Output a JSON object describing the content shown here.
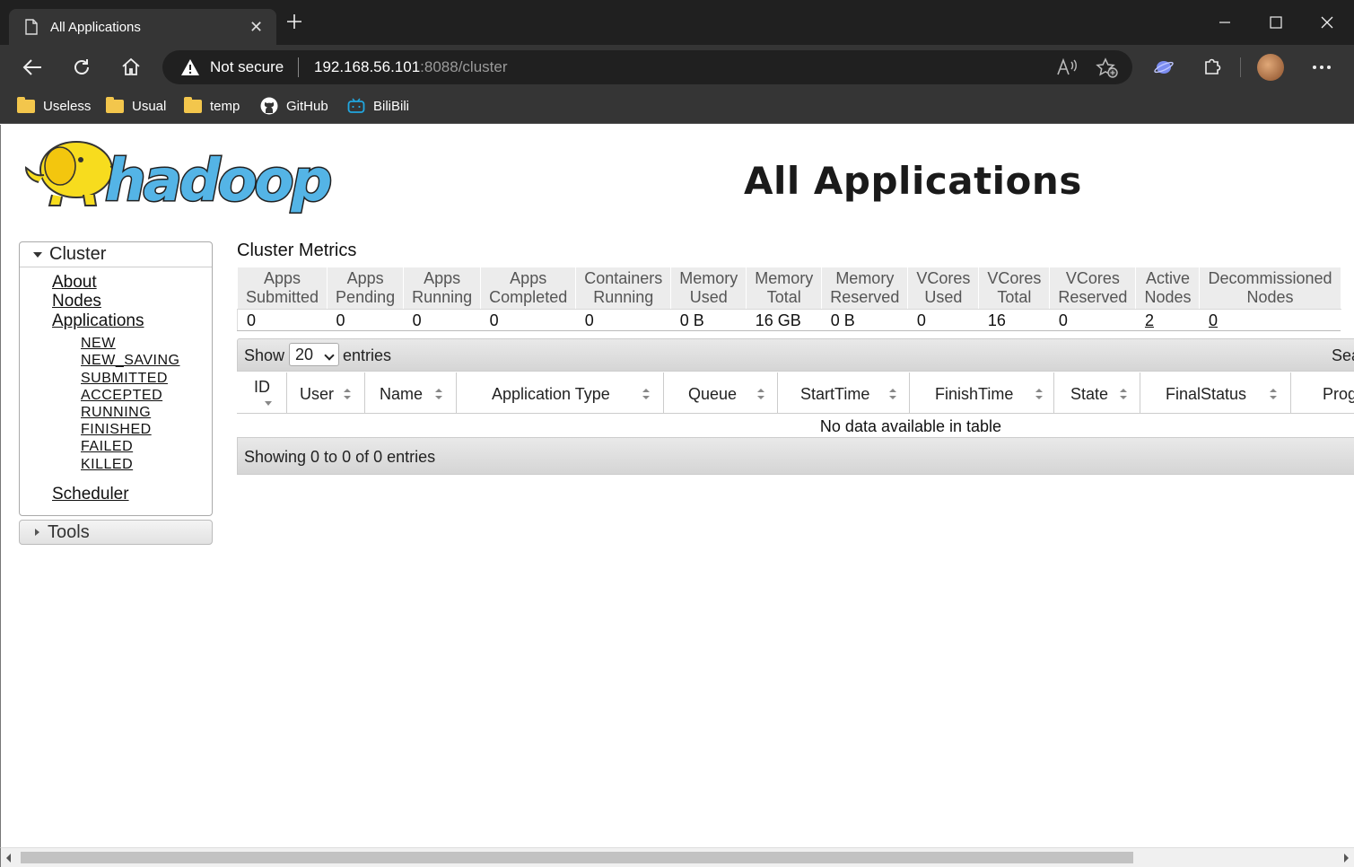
{
  "browser": {
    "tab_title": "All Applications",
    "address": {
      "security_label": "Not secure",
      "host": "192.168.56.101",
      "port_path": ":8088/cluster"
    },
    "bookmarks": [
      {
        "label": "Useless",
        "icon": "folder-icon"
      },
      {
        "label": "Usual",
        "icon": "folder-icon"
      },
      {
        "label": "temp",
        "icon": "folder-icon"
      },
      {
        "label": "GitHub",
        "icon": "github-icon"
      },
      {
        "label": "BiliBili",
        "icon": "bilibili-icon"
      }
    ]
  },
  "page": {
    "logo_text": "hadoop",
    "title": "All Applications"
  },
  "nav": {
    "cluster_label": "Cluster",
    "about": "About",
    "nodes": "Nodes",
    "applications": "Applications",
    "app_states": [
      "NEW",
      "NEW_SAVING",
      "SUBMITTED",
      "ACCEPTED",
      "RUNNING",
      "FINISHED",
      "FAILED",
      "KILLED"
    ],
    "scheduler": "Scheduler",
    "tools_label": "Tools"
  },
  "metrics": {
    "title": "Cluster Metrics",
    "headers": [
      [
        "Apps",
        "Submitted"
      ],
      [
        "Apps",
        "Pending"
      ],
      [
        "Apps",
        "Running"
      ],
      [
        "Apps",
        "Completed"
      ],
      [
        "Containers",
        "Running"
      ],
      [
        "Memory",
        "Used"
      ],
      [
        "Memory",
        "Total"
      ],
      [
        "Memory",
        "Reserved"
      ],
      [
        "VCores",
        "Used"
      ],
      [
        "VCores",
        "Total"
      ],
      [
        "VCores",
        "Reserved"
      ],
      [
        "Active",
        "Nodes"
      ],
      [
        "Decommissioned",
        "Nodes"
      ]
    ],
    "values": [
      "0",
      "0",
      "0",
      "0",
      "0",
      "0 B",
      "16 GB",
      "0 B",
      "0",
      "16",
      "0",
      "2",
      "0"
    ]
  },
  "apps_table": {
    "show_label": "Show",
    "page_length": "20",
    "entries_label": "entries",
    "search_label": "Sea",
    "columns": [
      "ID",
      "User",
      "Name",
      "Application Type",
      "Queue",
      "StartTime",
      "FinishTime",
      "State",
      "FinalStatus",
      "Prog"
    ],
    "empty_message": "No data available in table",
    "info": "Showing 0 to 0 of 0 entries"
  },
  "colors": {
    "chrome_dark": "#202020",
    "chrome_mid": "#353535",
    "logo_yellow": "#f7dc1e",
    "logo_blue": "#54b4e6"
  }
}
